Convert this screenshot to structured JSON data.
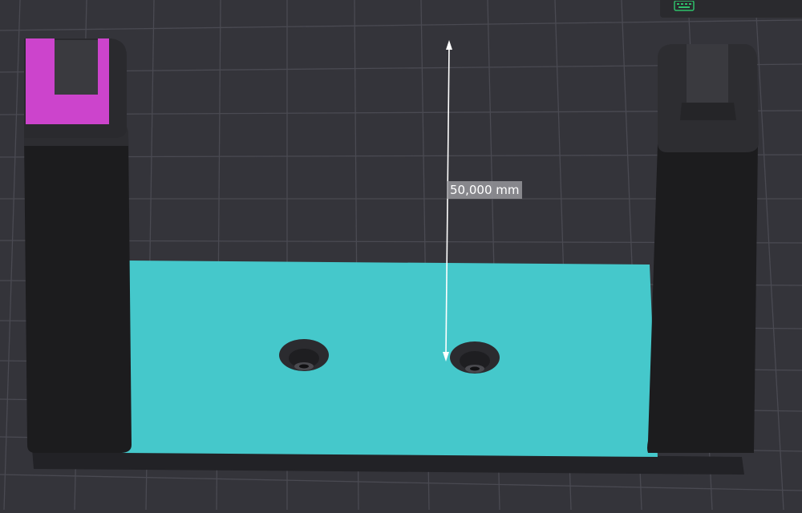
{
  "viewport": {
    "measurement": {
      "label": "50,000 mm"
    },
    "colors": {
      "background": "#34343a",
      "grid_line": "#4a4a52",
      "base_plate": "#45c8cb",
      "selected_part": "#cc44cc",
      "model_body": "#1c1c1e",
      "model_top": "#2d2d31"
    },
    "toolbar": {
      "icon": "keyboard-icon"
    }
  }
}
